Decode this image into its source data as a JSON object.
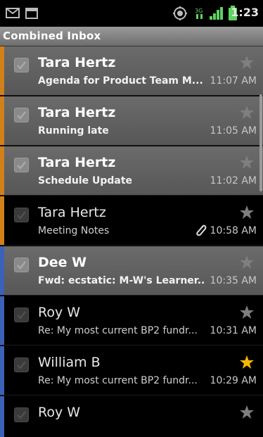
{
  "status": {
    "time": "1:23"
  },
  "header": {
    "title": "Combined Inbox"
  },
  "colors": {
    "orange": "#d2801a",
    "blue": "#3b62b8",
    "star_on": "#f5b800",
    "star_off": "#7f7f7f"
  },
  "messages": [
    {
      "sender": "Tara Hertz",
      "subject": "Agenda for Product Team M...",
      "time": "11:07 AM",
      "unread": true,
      "starred": false,
      "attachment": false
    },
    {
      "sender": "Tara Hertz",
      "subject": "Running late",
      "time": "11:05 AM",
      "unread": true,
      "starred": false,
      "attachment": false
    },
    {
      "sender": "Tara Hertz",
      "subject": "Schedule Update",
      "time": "11:02 AM",
      "unread": true,
      "starred": false,
      "attachment": false
    },
    {
      "sender": "Tara Hertz",
      "subject": "Meeting Notes",
      "time": "10:58 AM",
      "unread": false,
      "starred": false,
      "attachment": true
    },
    {
      "sender": "Dee W",
      "subject": "Fwd: ecstatic: M-W's Learner...",
      "time": "10:35 AM",
      "unread": true,
      "starred": false,
      "attachment": false
    },
    {
      "sender": "Roy W",
      "subject": "Re: My most current BP2 fundr...",
      "time": "10:31 AM",
      "unread": false,
      "starred": false,
      "attachment": false
    },
    {
      "sender": "William B",
      "subject": "Re: My most current BP2 fundr...",
      "time": "10:29 AM",
      "unread": false,
      "starred": true,
      "attachment": false
    },
    {
      "sender": "Roy W",
      "subject": "",
      "time": "",
      "unread": false,
      "starred": false,
      "attachment": false
    }
  ]
}
